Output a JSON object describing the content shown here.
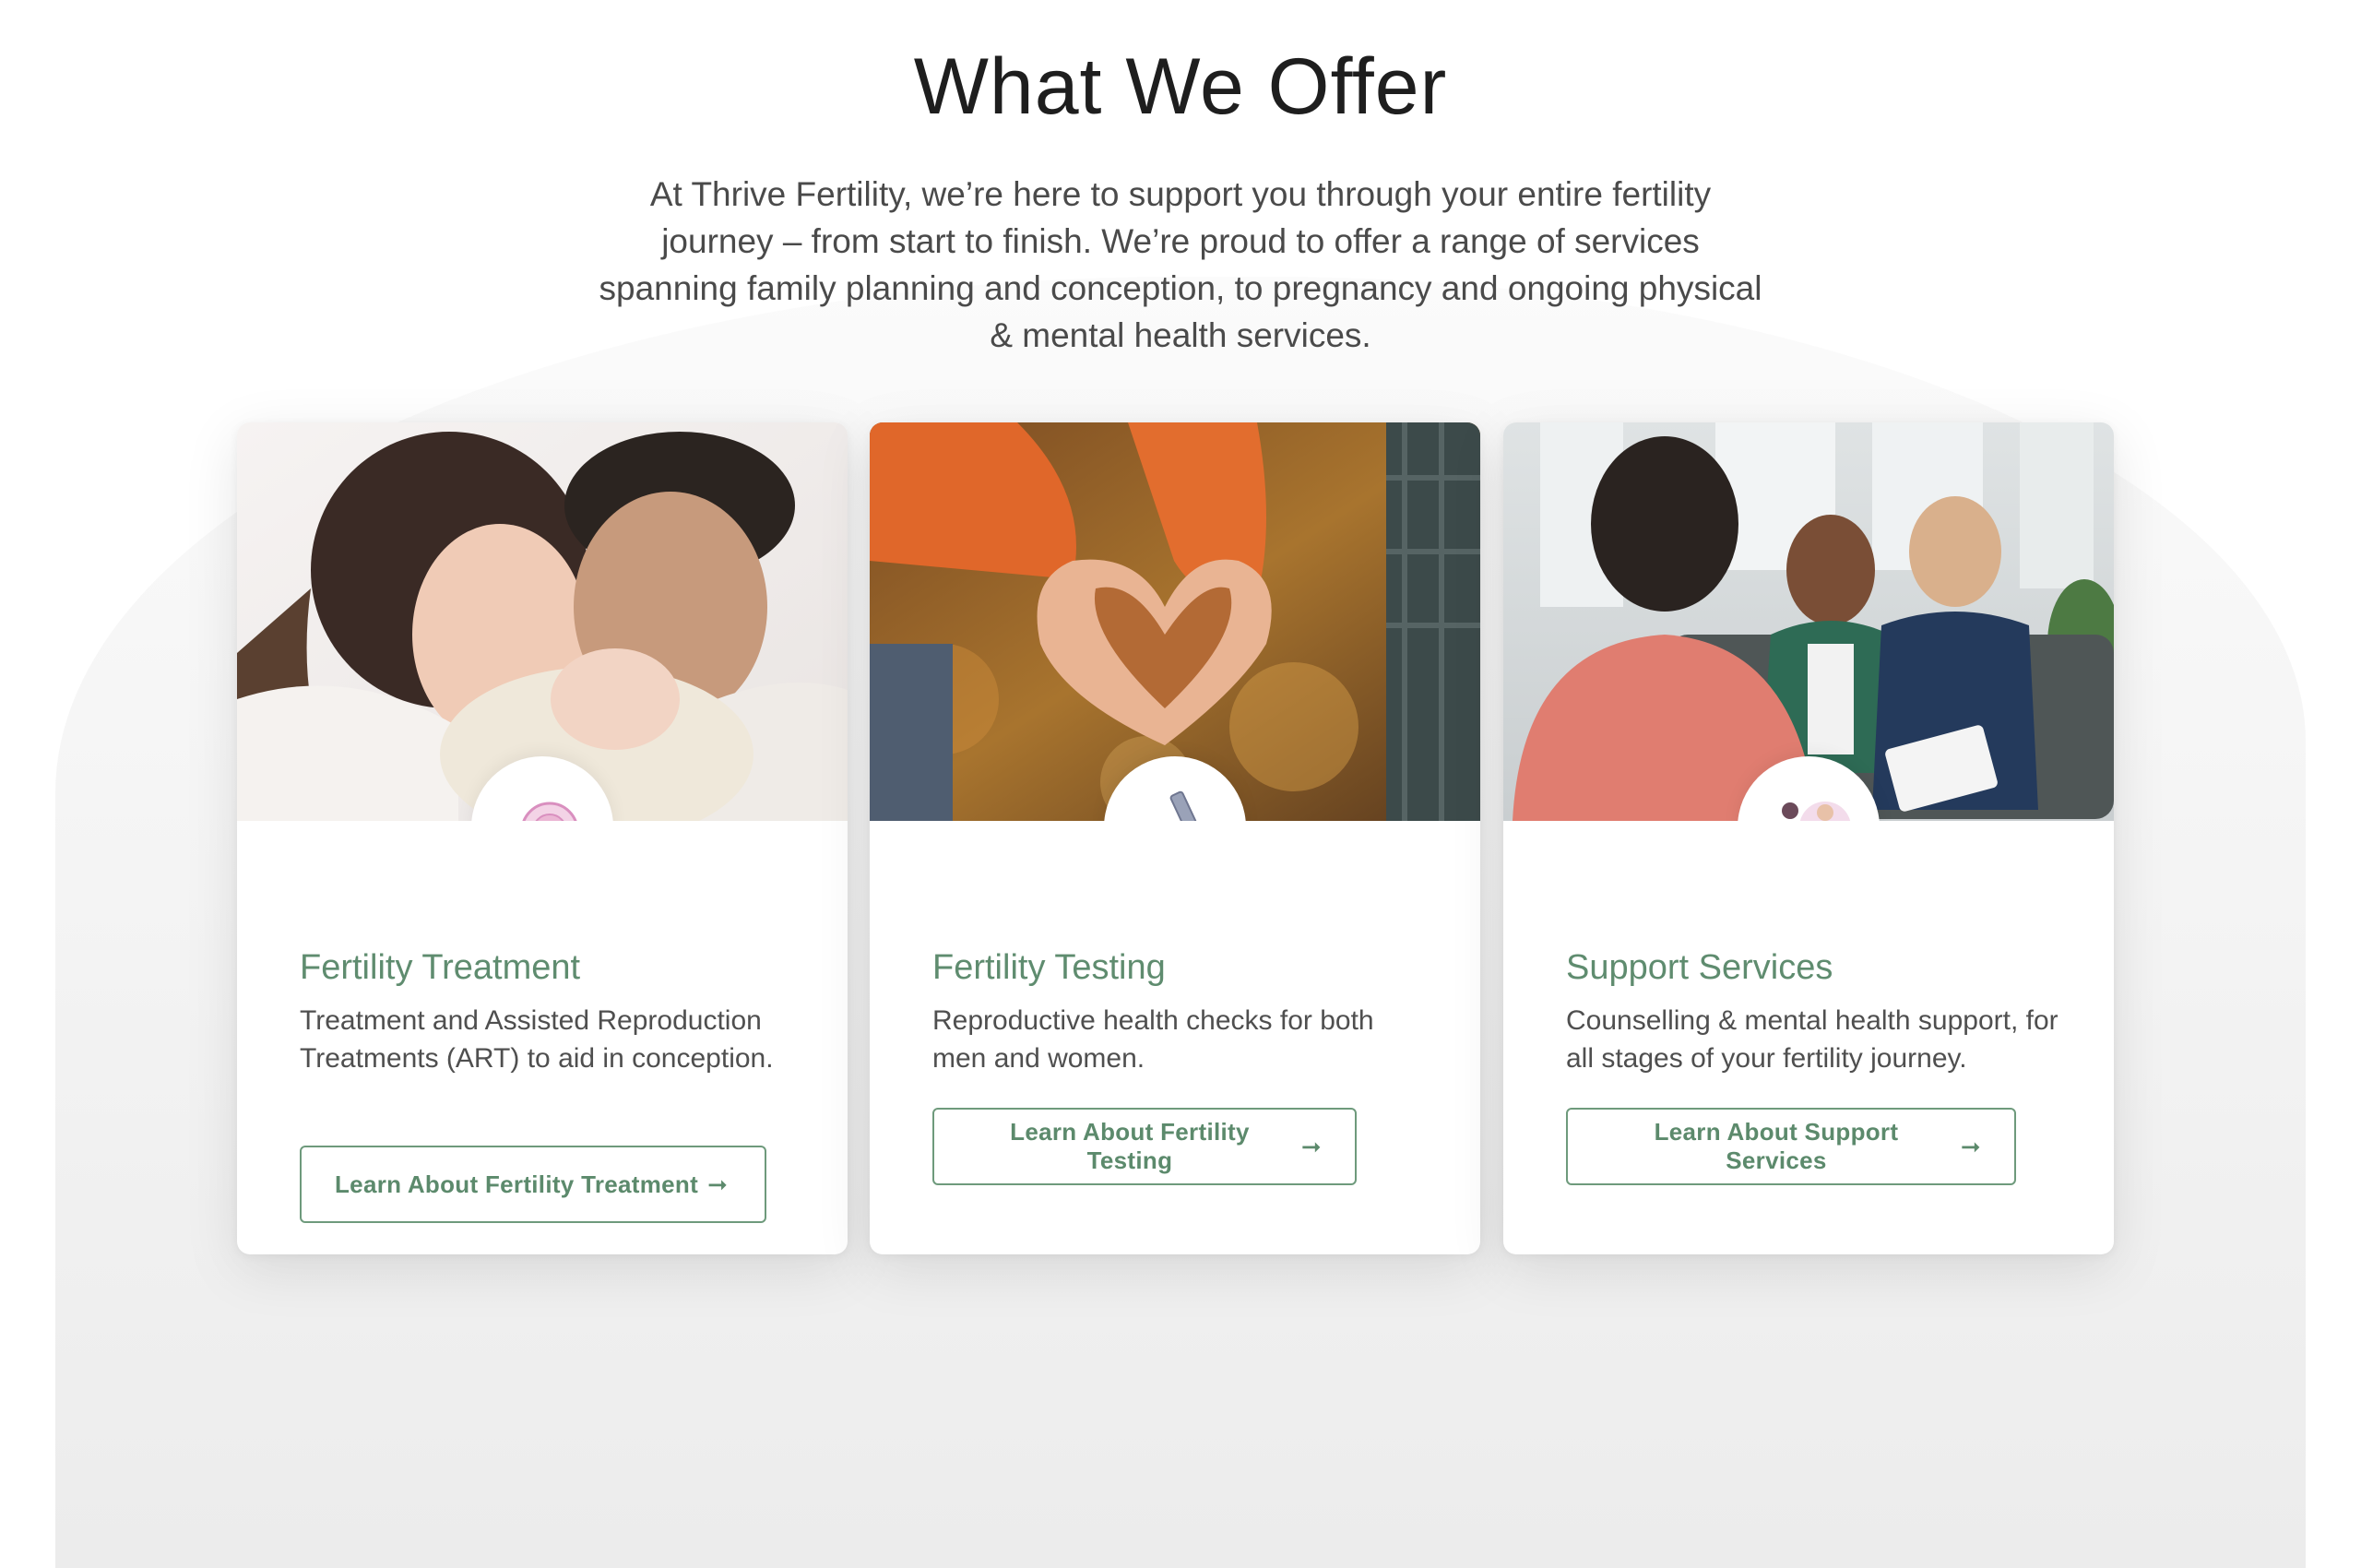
{
  "section": {
    "title": "What We Offer",
    "intro": "At Thrive Fertility, we’re here to support you through your entire fertility journey – from start to finish. We’re proud to offer a range of services spanning family planning and conception, to pregnancy and ongoing physical & mental health services."
  },
  "cards": [
    {
      "title": "Fertility Treatment",
      "description": "Treatment and Assisted Reproduction Treatments (ART) to aid in conception.",
      "button_label": "Learn About Fertility Treatment",
      "photo": "couple-with-newborn-photo",
      "icon": "egg-cell-icon"
    },
    {
      "title": "Fertility Testing",
      "description": "Reproductive health checks for both men and women.",
      "button_label": "Learn About Fertility Testing",
      "photo": "heart-hands-photo",
      "icon": "microscope-icon"
    },
    {
      "title": "Support Services",
      "description": "Counselling & mental health support, for all stages of your fertility journey.",
      "button_label": "Learn About Support Services",
      "photo": "counselling-session-photo",
      "icon": "counselling-people-icon"
    }
  ],
  "arrow_glyph": "➞",
  "colors": {
    "accent_green": "#5f8c6f",
    "heading": "#1e1e1e",
    "body_text": "#4f4f4f",
    "icon_pink": "#d98fbf",
    "background": "#ffffff"
  }
}
